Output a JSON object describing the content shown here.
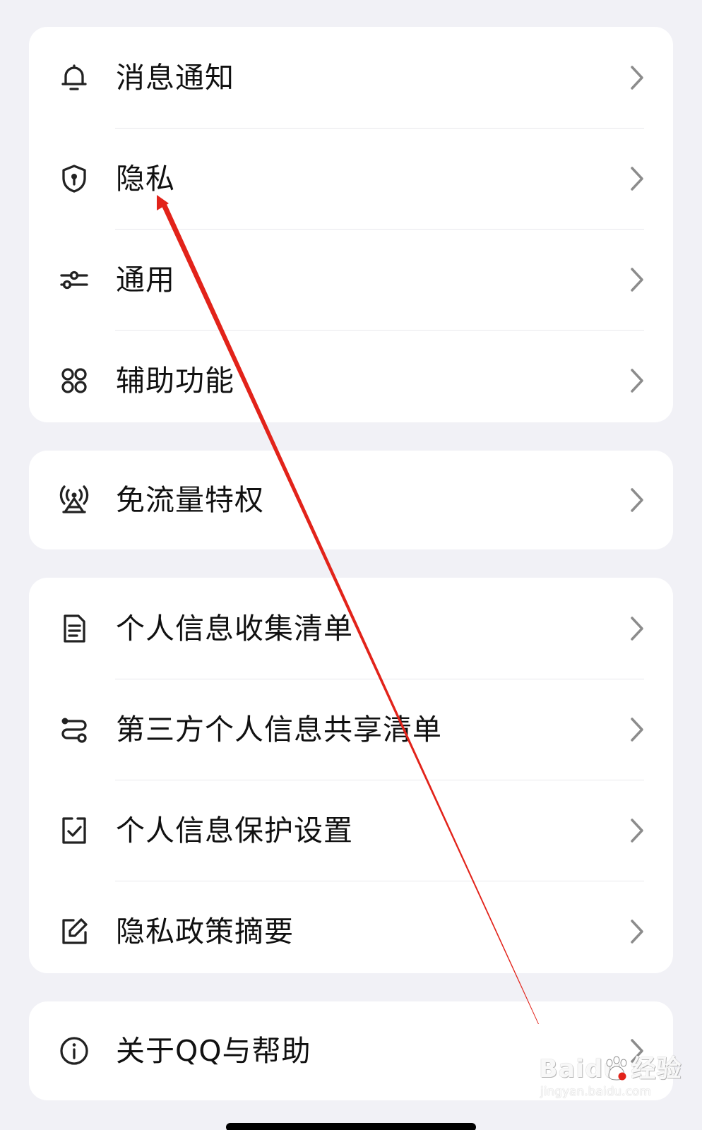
{
  "settings": {
    "group1": [
      {
        "label": "消息通知",
        "icon": "bell-icon"
      },
      {
        "label": "隐私",
        "icon": "shield-lock-icon"
      },
      {
        "label": "通用",
        "icon": "sliders-icon"
      },
      {
        "label": "辅助功能",
        "icon": "grid-icon"
      }
    ],
    "group2": [
      {
        "label": "免流量特权",
        "icon": "signal-tower-icon"
      }
    ],
    "group3": [
      {
        "label": "个人信息收集清单",
        "icon": "document-icon"
      },
      {
        "label": "第三方个人信息共享清单",
        "icon": "share-route-icon"
      },
      {
        "label": "个人信息保护设置",
        "icon": "checkbox-icon"
      },
      {
        "label": "隐私政策摘要",
        "icon": "edit-icon"
      }
    ],
    "group4": [
      {
        "label": "关于QQ与帮助",
        "icon": "info-icon"
      }
    ]
  },
  "watermark": {
    "brand_text": "Baidu 经验",
    "url_text": "jingyan.baidu.com"
  },
  "colors": {
    "background": "#f1f1f6",
    "card": "#ffffff",
    "text": "#111111",
    "chevron": "#8c8c8c",
    "annotation_arrow": "#e2231a"
  }
}
